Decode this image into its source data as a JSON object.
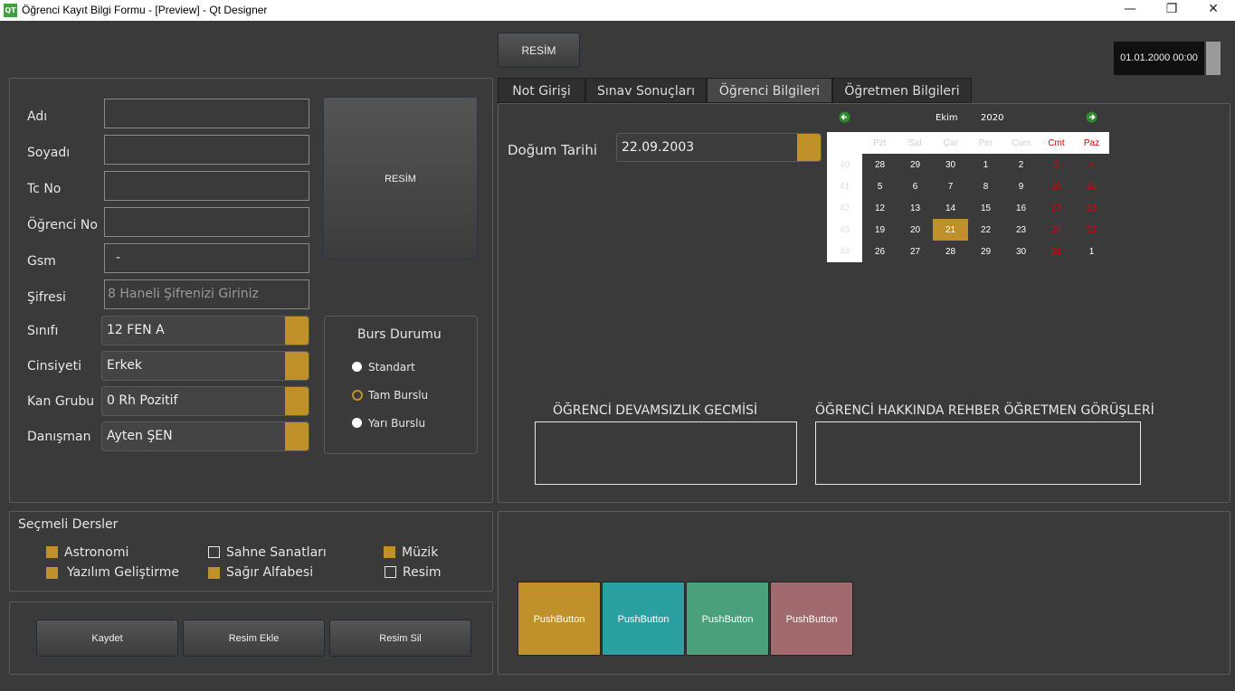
{
  "window": {
    "title": "Öğrenci Kayıt Bilgi Formu - [Preview] - Qt Designer",
    "app_icon": "QT",
    "controls": {
      "minimize": "—",
      "maximize": "❐",
      "close": "✕"
    }
  },
  "top": {
    "resim_button": "RESİM",
    "datetime": "01.01.2000 00:00"
  },
  "form": {
    "labels": {
      "adi": "Adı",
      "soyadi": "Soyadı",
      "tcno": "Tc No",
      "ogrno": "Öğrenci No",
      "gsm": "Gsm",
      "sifre": "Şifresi",
      "sinifi": "Sınıfı",
      "cinsiyeti": "Cinsiyeti",
      "kangrubu": "Kan Grubu",
      "danisman": "Danışman"
    },
    "values": {
      "adi": "",
      "soyadi": "",
      "tcno": "",
      "ogrno": "",
      "gsm": " -",
      "sifre_placeholder": "8 Haneli Şifrenizi Giriniz",
      "sinifi": "12 FEN A",
      "cinsiyeti": "Erkek",
      "kangrubu": "0 Rh Pozitif",
      "danisman": "Ayten ŞEN"
    },
    "photo_button": "RESİM"
  },
  "burs": {
    "title": "Burs Durumu",
    "options": [
      "Standart",
      "Tam Burslu",
      "Yarı Burslu"
    ],
    "selected": "Tam Burslu"
  },
  "secmeli": {
    "title": "Seçmeli Dersler",
    "items": [
      {
        "label": "Astronomi",
        "checked": true
      },
      {
        "label": "Sahne Sanatları",
        "checked": false
      },
      {
        "label": "Müzik",
        "checked": true
      },
      {
        "label": "Yazılım Geliştirme",
        "checked": true
      },
      {
        "label": "Sağır Alfabesi",
        "checked": true
      },
      {
        "label": "Resim",
        "checked": false
      }
    ]
  },
  "actions": {
    "save": "Kaydet",
    "add_photo": "Resim Ekle",
    "delete_photo": "Resim Sil"
  },
  "tabs": [
    "Not Girişi",
    "Sınav Sonuçları",
    "Öğrenci Bilgileri",
    "Öğretmen Bilgileri"
  ],
  "active_tab": "Öğrenci Bilgileri",
  "student_info": {
    "dogum_label": "Doğum Tarihi",
    "dogum_value": "22.09.2003",
    "devamsizlik_label": "ÖĞRENCİ DEVAMSIZLIK GECMİSİ",
    "rehber_label": "ÖĞRENCİ HAKKINDA REHBER ÖĞRETMEN GÖRÜŞLERİ"
  },
  "calendar": {
    "month": "Ekim",
    "year": "2020",
    "weekdays": [
      "Pzt",
      "Sal",
      "Çar",
      "Per",
      "Cum",
      "Cmt",
      "Paz"
    ],
    "week_numbers": [
      "40",
      "41",
      "42",
      "43",
      "44",
      "45"
    ],
    "days": [
      [
        "28",
        "29",
        "30",
        "1",
        "2",
        "3",
        "4"
      ],
      [
        "5",
        "6",
        "7",
        "8",
        "9",
        "10",
        "11"
      ],
      [
        "12",
        "13",
        "14",
        "15",
        "16",
        "17",
        "18"
      ],
      [
        "19",
        "20",
        "21",
        "22",
        "23",
        "24",
        "25"
      ],
      [
        "26",
        "27",
        "28",
        "29",
        "30",
        "31",
        "1"
      ]
    ],
    "selected_day": "21"
  },
  "push_buttons": [
    {
      "label": "PushButton",
      "color": "#c0902a"
    },
    {
      "label": "PushButton",
      "color": "#2aa0a0"
    },
    {
      "label": "PushButton",
      "color": "#4aa07a"
    },
    {
      "label": "PushButton",
      "color": "#a06a6e"
    }
  ],
  "colors": {
    "accent": "#c0902a",
    "background": "#3a3a3a",
    "weekend": "#e00000"
  }
}
